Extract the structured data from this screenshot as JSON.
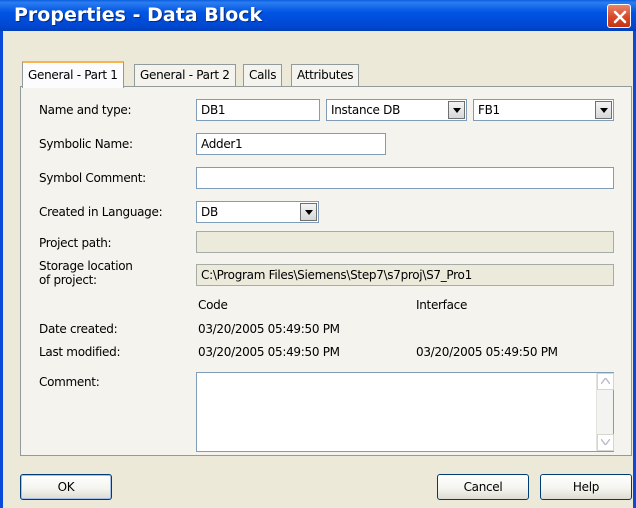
{
  "window": {
    "title": "Properties - Data Block"
  },
  "tabs": [
    {
      "label": "General - Part 1",
      "active": true
    },
    {
      "label": "General - Part 2",
      "active": false
    },
    {
      "label": "Calls",
      "active": false
    },
    {
      "label": "Attributes",
      "active": false
    }
  ],
  "form": {
    "name_and_type": {
      "label": "Name and type:",
      "name_value": "DB1",
      "type_value": "Instance DB",
      "fb_value": "FB1"
    },
    "symbolic_name": {
      "label": "Symbolic Name:",
      "value": "Adder1"
    },
    "symbol_comment": {
      "label": "Symbol Comment:",
      "value": ""
    },
    "created_in_language": {
      "label": "Created in Language:",
      "value": "DB"
    },
    "project_path": {
      "label": "Project path:",
      "value": ""
    },
    "storage_location": {
      "label": "Storage location\nof project:",
      "value": "C:\\Program Files\\Siemens\\Step7\\s7proj\\S7_Pro1"
    },
    "columns": {
      "code": "Code",
      "interface": "Interface"
    },
    "date_created": {
      "label": "Date created:",
      "code": "03/20/2005 05:49:50 PM",
      "interface": ""
    },
    "last_modified": {
      "label": "Last modified:",
      "code": "03/20/2005 05:49:50 PM",
      "interface": "03/20/2005 05:49:50 PM"
    },
    "comment": {
      "label": "Comment:",
      "value": ""
    }
  },
  "buttons": {
    "ok": "OK",
    "cancel": "Cancel",
    "help": "Help"
  },
  "icons": {
    "close": "close-icon",
    "dropdown": "chevron-down-icon",
    "scroll_up": "scroll-up-icon",
    "scroll_down": "scroll-down-icon"
  },
  "colors": {
    "titlebar": "#0054e3",
    "close_button": "#d9482a",
    "dialog_bg": "#ece9d8",
    "active_tab_highlight": "#f8b450"
  }
}
